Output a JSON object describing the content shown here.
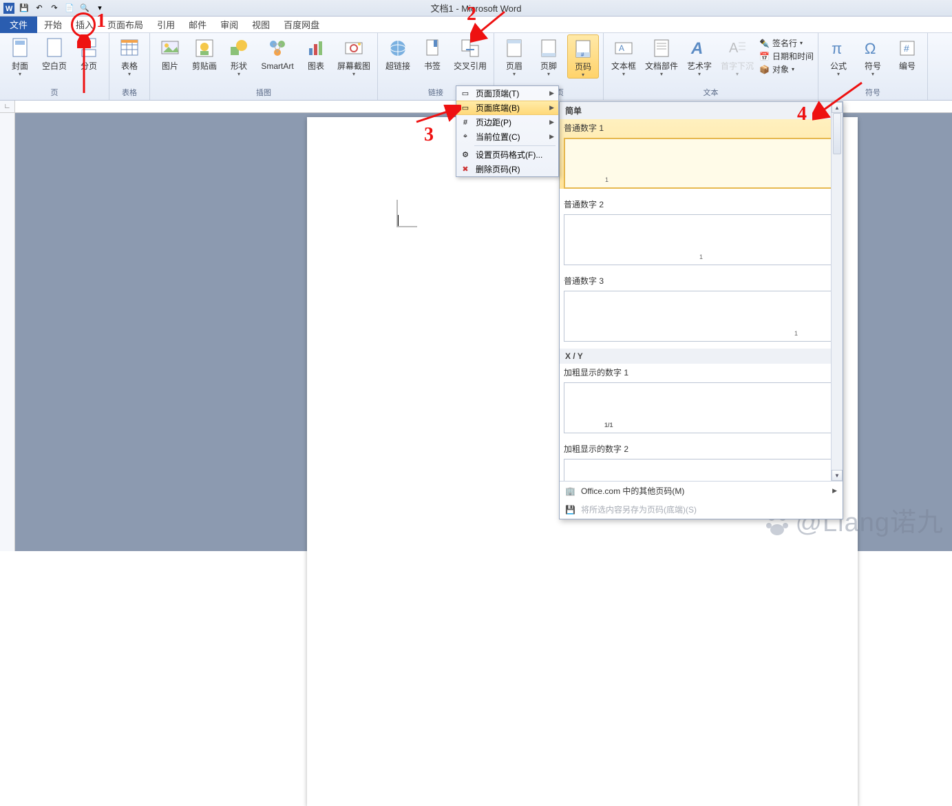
{
  "title": "文档1 - Microsoft Word",
  "tabs": {
    "file": "文件",
    "home": "开始",
    "insert": "插入",
    "layout": "页面布局",
    "references": "引用",
    "mailings": "邮件",
    "review": "审阅",
    "view": "视图",
    "baidu": "百度网盘"
  },
  "ribbon": {
    "groups": {
      "pages": {
        "label": "页",
        "cover": "封面",
        "blank": "空白页",
        "break": "分页"
      },
      "tables": {
        "label": "表格",
        "table": "表格"
      },
      "illustrations": {
        "label": "插图",
        "picture": "图片",
        "clipart": "剪贴画",
        "shapes": "形状",
        "smartart": "SmartArt",
        "chart": "图表",
        "screenshot": "屏幕截图"
      },
      "links": {
        "label": "链接",
        "hyperlink": "超链接",
        "bookmark": "书签",
        "crossref": "交叉引用"
      },
      "headerfooter": {
        "label": "页眉和页",
        "header": "页眉",
        "footer": "页脚",
        "pagenum": "页码"
      },
      "text": {
        "label": "文本",
        "textbox": "文本框",
        "quickparts": "文档部件",
        "wordart": "艺术字",
        "dropcap": "首字下沉",
        "signature": "签名行",
        "datetime": "日期和时间",
        "object": "对象"
      },
      "symbols": {
        "label": "符号",
        "equation": "公式",
        "symbol": "符号",
        "number": "编号"
      }
    }
  },
  "pagenum_menu": {
    "top": "页面顶端(T)",
    "bottom": "页面底端(B)",
    "margins": "页边距(P)",
    "current": "当前位置(C)",
    "format": "设置页码格式(F)...",
    "remove": "删除页码(R)"
  },
  "gallery": {
    "section_simple": "简单",
    "plain1": "普通数字 1",
    "plain2": "普通数字 2",
    "plain3": "普通数字 3",
    "section_xy": "X / Y",
    "bold1": "加粗显示的数字 1",
    "bold2": "加粗显示的数字 2",
    "sample1": "1",
    "sample_xy": "1/1",
    "more": "Office.com 中的其他页码(M)",
    "save": "将所选内容另存为页码(底端)(S)"
  },
  "annotations": {
    "n1": "1",
    "n2": "2",
    "n3": "3",
    "n4": "4"
  },
  "watermark": "@Liang诺九"
}
